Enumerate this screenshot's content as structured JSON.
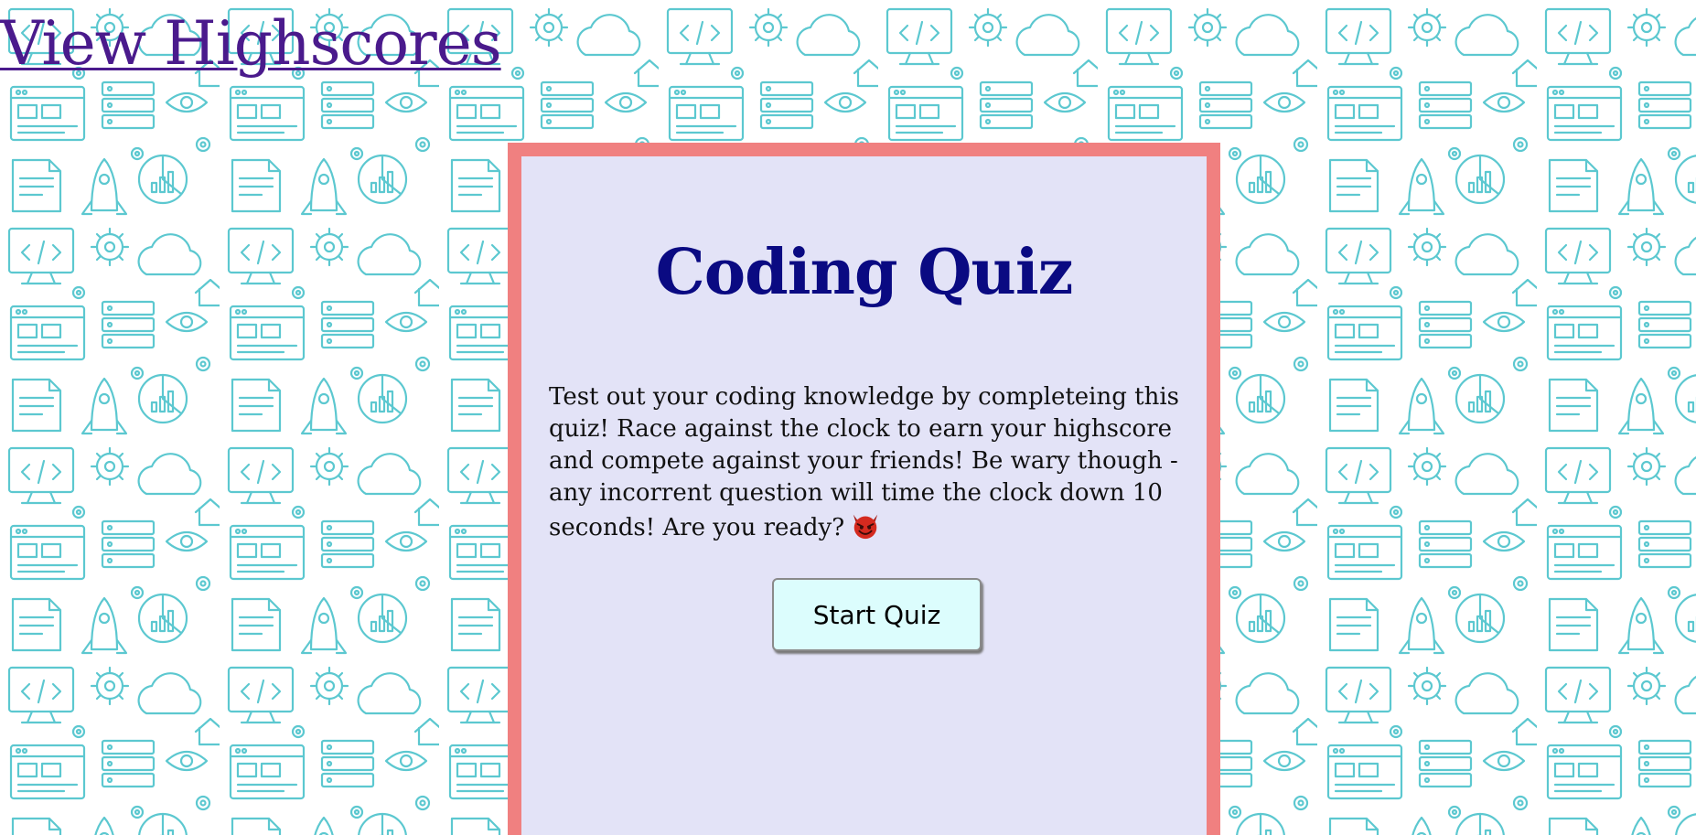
{
  "nav": {
    "highscores_label": "View Highscores"
  },
  "quiz": {
    "title": "Coding Quiz",
    "description": "Test out your coding knowledge by completeing this quiz! Race against the clock to earn your highscore and compete against your friends! Be wary though - any incorrent question will time the clock down 10 seconds! Are you ready?",
    "emoji_icon": "smiling-devil-icon",
    "start_label": "Start Quiz"
  },
  "colors": {
    "card_background": "#e3e3f7",
    "card_border": "#f08080",
    "title": "#0a0a82",
    "link": "#4a1a8c",
    "button_background": "#dcfdfd",
    "pattern_stroke": "#5cc8d0"
  }
}
